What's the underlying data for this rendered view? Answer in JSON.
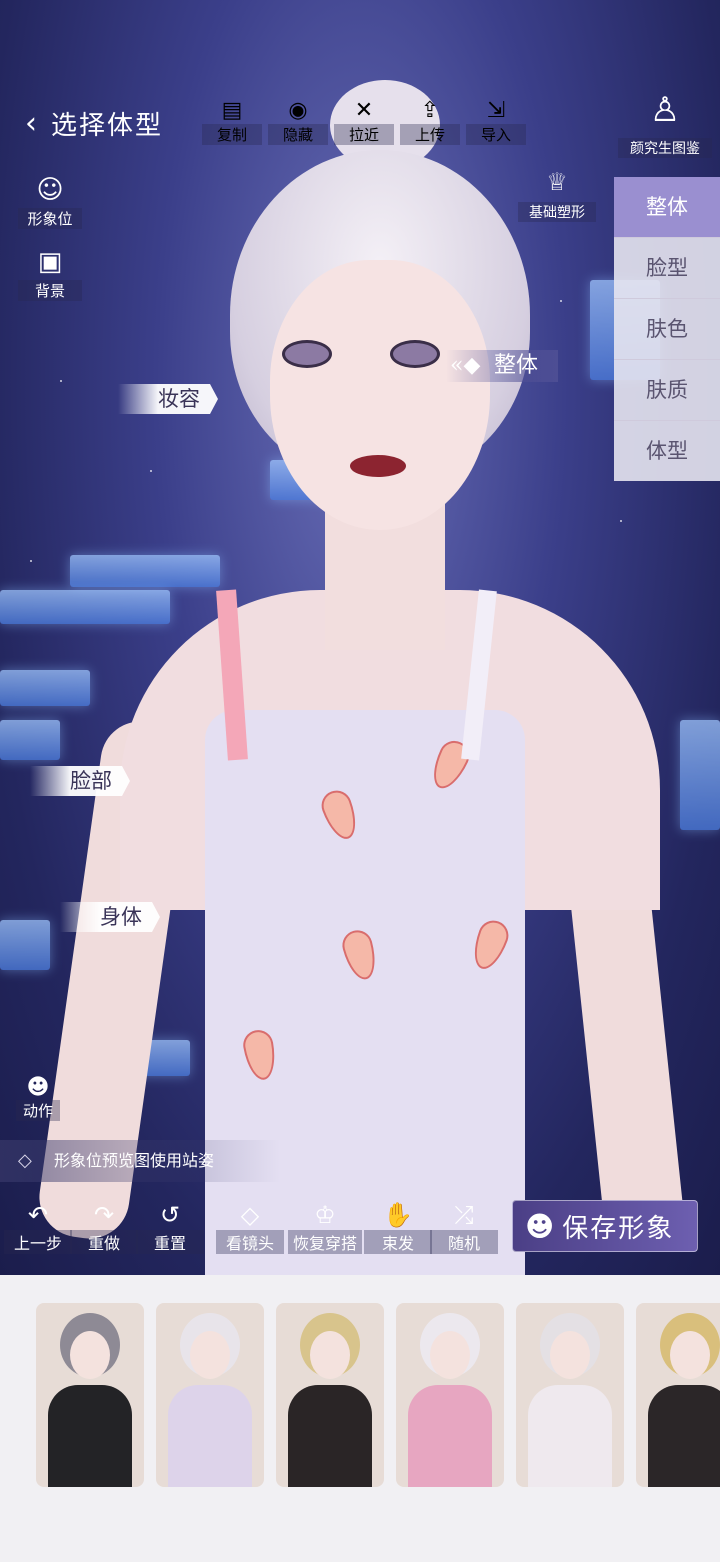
{
  "header": {
    "back_label": "选择体型",
    "tools": [
      {
        "icon": "copy-icon",
        "glyph": "▤",
        "label": "复制"
      },
      {
        "icon": "hide-eye-icon",
        "glyph": "◉",
        "label": "隐藏"
      },
      {
        "icon": "zoom-in-icon",
        "glyph": "✕",
        "label": "拉近"
      },
      {
        "icon": "upload-icon",
        "glyph": "⇪",
        "label": "上传"
      },
      {
        "icon": "import-icon",
        "glyph": "⇲",
        "label": "导入"
      }
    ],
    "research_label": "颜究生图鉴"
  },
  "left_tools": [
    {
      "icon": "portrait-slot-icon",
      "glyph": "☺",
      "label": "形象位"
    },
    {
      "icon": "background-image-icon",
      "glyph": "▣",
      "label": "背景"
    }
  ],
  "basic_shape_label": "基础塑形",
  "right_tabs": [
    "整体",
    "脸型",
    "肤色",
    "肤质",
    "体型"
  ],
  "tags": {
    "makeup": "妆容",
    "whole": "整体",
    "face": "脸部",
    "body": "身体"
  },
  "action_label": "动作",
  "stance_text": "形象位预览图使用站姿",
  "bottom_tools": [
    {
      "icon": "undo-icon",
      "glyph": "↶",
      "label": "上一步"
    },
    {
      "icon": "redo-icon",
      "glyph": "↷",
      "label": "重做"
    },
    {
      "icon": "reset-icon",
      "glyph": "↺",
      "label": "重置"
    },
    {
      "icon": "view-lens-icon",
      "glyph": "◇",
      "label": "看镜头"
    },
    {
      "icon": "restore-outfit-icon",
      "glyph": "♔",
      "label": "恢复穿搭"
    },
    {
      "icon": "tie-hair-icon",
      "glyph": "✋",
      "label": "束发"
    },
    {
      "icon": "random-icon",
      "glyph": "⤮",
      "label": "随机"
    }
  ],
  "save_label": "保存形象",
  "colors": {
    "accent": "#9a8fd0",
    "save_bg": "#5a4d9c",
    "scene_bg": "#2a2d6b"
  },
  "thumbnails": [
    {
      "hair": "#8e8a95",
      "outfit": "#232326"
    },
    {
      "hair": "#e8e4ea",
      "outfit": "#ddd3ea"
    },
    {
      "hair": "#d8c48c",
      "outfit": "#2a2526"
    },
    {
      "hair": "#ece8ee",
      "outfit": "#e7a6c1"
    },
    {
      "hair": "#e4e0e4",
      "outfit": "#efe9ee"
    },
    {
      "hair": "#d9bf7c",
      "outfit": "#2b2628"
    }
  ]
}
